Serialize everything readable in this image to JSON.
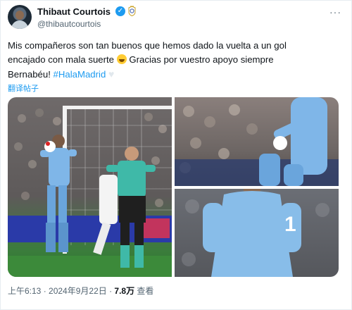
{
  "tweet": {
    "author_name": "Thibaut Courtois",
    "author_handle": "@thibautcourtois",
    "text_line1": "Mis compañeros son tan buenos que hemos dado la vuelta a un gol",
    "text_line2": "encajado con mala suerte",
    "text_line2b": " Gracias por vuestro apoyo siempre",
    "text_line3": "Bernabéu! ",
    "hashtag": "#HalaMadrid",
    "translate_label": "翻译帖子",
    "timestamp": "上午6:13 · 2024年9月22日 · ",
    "views_count": "7.8万",
    "views_label": " 查看"
  },
  "media": {
    "photo1_caption": "Courtois catching ball in front of referee",
    "photo2_caption": "Courtois hands close-up",
    "photo3_caption": "Courtois back with number 1",
    "jersey_number": "1"
  },
  "icons": {
    "verified": "verified-badge-icon",
    "club": "real-madrid-crest-icon",
    "more": "more-options-icon",
    "heart": "white-heart-icon",
    "grin": "grinning-sweat-emoji-icon"
  },
  "colors": {
    "link": "#1d9bf0",
    "secondary_text": "#536471",
    "primary_text": "#0f1419"
  }
}
